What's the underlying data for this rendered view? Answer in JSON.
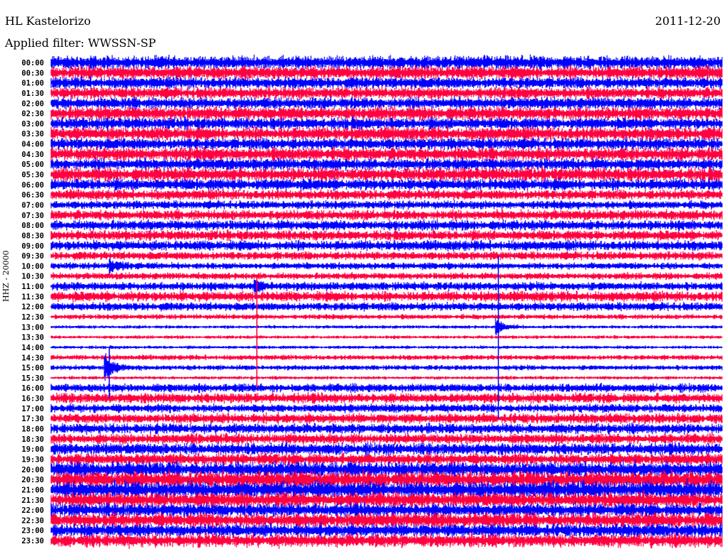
{
  "header": {
    "station": "HL Kastelorizo",
    "date": "2011-12-20",
    "filter": "Applied filter: WWSSN-SP"
  },
  "chart_data": {
    "type": "line",
    "title": "HL Kastelorizo 2011-12-20",
    "ylabel": "HHZ - 20000",
    "xlabel": "",
    "row_minutes": 30,
    "colors": [
      "#0000ff",
      "#ff0040"
    ],
    "row_labels": [
      "00:00",
      "00:30",
      "01:00",
      "01:30",
      "02:00",
      "02:30",
      "03:00",
      "03:30",
      "04:00",
      "04:30",
      "05:00",
      "05:30",
      "06:00",
      "06:30",
      "07:00",
      "07:30",
      "08:00",
      "08:30",
      "09:00",
      "09:30",
      "10:00",
      "10:30",
      "11:00",
      "11:30",
      "12:00",
      "12:30",
      "13:00",
      "13:30",
      "14:00",
      "14:30",
      "15:00",
      "15:30",
      "16:00",
      "16:30",
      "17:00",
      "17:30",
      "18:00",
      "18:30",
      "19:00",
      "19:30",
      "20:00",
      "20:30",
      "21:00",
      "21:30",
      "22:00",
      "22:30",
      "23:00",
      "23:30"
    ],
    "noise_level": [
      8,
      8,
      7,
      7,
      7,
      8,
      7,
      8,
      7,
      8,
      7,
      8,
      7,
      6,
      5,
      6,
      6,
      6,
      6,
      5,
      4,
      4,
      5,
      6,
      5,
      3,
      2,
      2,
      2,
      3,
      3,
      2,
      5,
      6,
      5,
      6,
      6,
      6,
      7,
      7,
      9,
      10,
      10,
      9,
      8,
      9,
      8,
      8
    ],
    "events": [
      {
        "row": "10:00",
        "minute": 2.7,
        "amplitude": 12
      },
      {
        "row": "11:00",
        "minute": 9.2,
        "amplitude": 8
      },
      {
        "row": "13:00",
        "minute": 20.0,
        "amplitude": 12
      },
      {
        "row": "15:00",
        "minute": 2.5,
        "amplitude": 22
      }
    ],
    "spikes": [
      {
        "minute": 2.6,
        "from_row": "14:00",
        "to_row": "16:30",
        "color": "#0000ff"
      },
      {
        "minute": 9.2,
        "from_row": "10:30",
        "to_row": "16:00",
        "color": "#ff0040"
      },
      {
        "minute": 20.0,
        "from_row": "09:30",
        "to_row": "17:30",
        "color": "#0000ff"
      }
    ]
  }
}
